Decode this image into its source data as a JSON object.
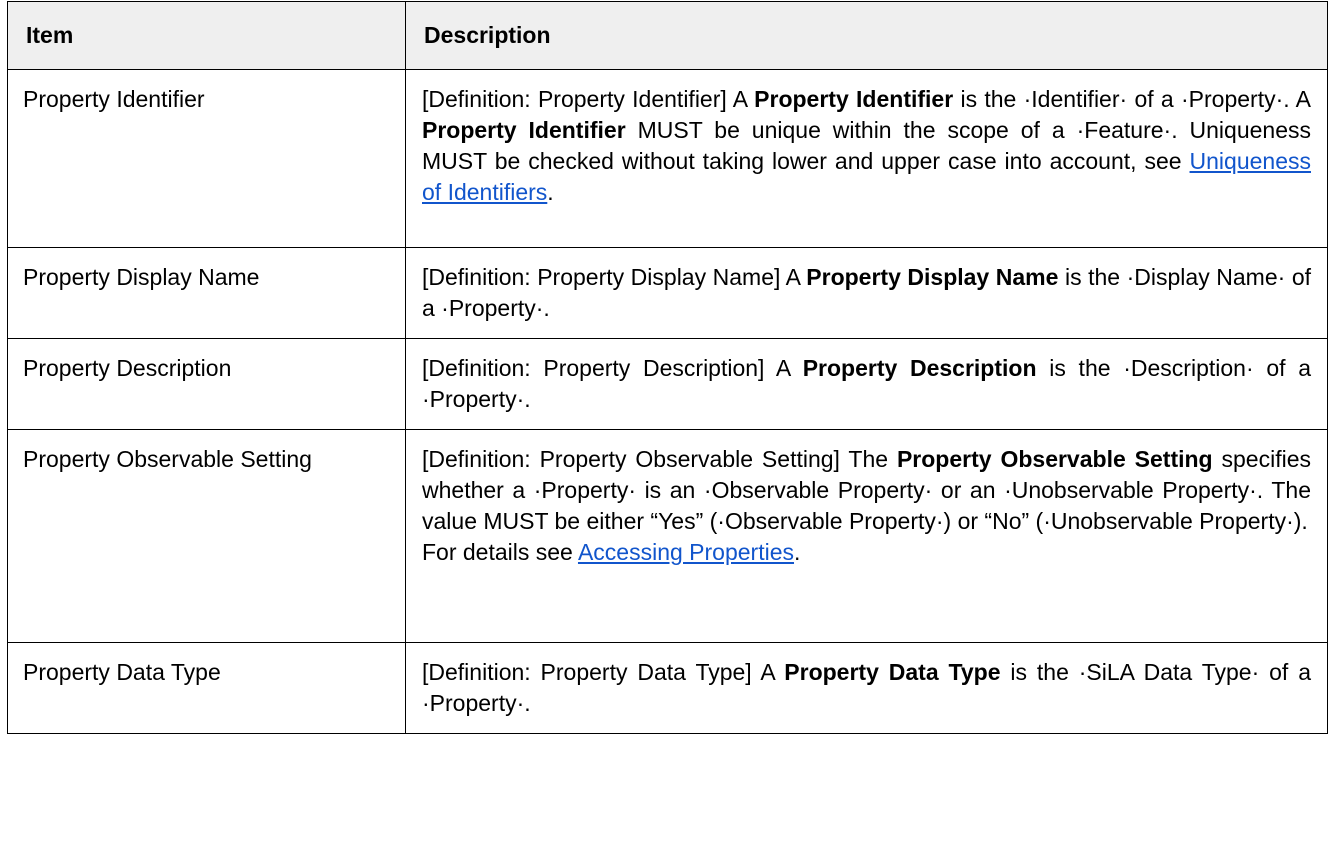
{
  "table": {
    "headers": {
      "item": "Item",
      "description": "Description"
    },
    "rows": [
      {
        "item": "Property Identifier",
        "desc": {
          "t1": "[Definition: Property Identifier] A ",
          "b1": "Property Identifier",
          "t2": " is the ·Identifier· of a ·Property·. A ",
          "b2": "Property Identifier",
          "t3": " MUST be unique within the scope of a ·Feature·. Uniqueness MUST be checked without taking lower and upper case into account, see ",
          "link": "Uniqueness of Identifiers",
          "t4": "."
        }
      },
      {
        "item": "Property Display Name",
        "desc": {
          "t1": "[Definition: Property Display Name] A ",
          "b1": "Property Display Name",
          "t2": " is the ·Display Name· of a ·Property·."
        }
      },
      {
        "item": "Property Description",
        "desc": {
          "t1": "[Definition: Property Description] A ",
          "b1": "Property Description",
          "t2": " is the ·Description· of a ·Property·."
        }
      },
      {
        "item": "Property Observable Setting",
        "desc": {
          "t1": "[Definition: Property Observable Setting] The ",
          "b1": "Property Observable Setting",
          "t2": " specifies whether a ·Property· is an ·Observable Property· or an ·Unobservable Property·. The value MUST be either “Yes” (·Observable Property·) or “No” (·Unobservable Property·).",
          "t3": "For details see ",
          "link": "Accessing Properties",
          "t4": "."
        }
      },
      {
        "item": "Property Data Type",
        "desc": {
          "t1": "[Definition: Property Data Type] A ",
          "b1": "Property Data Type",
          "t2": " is the ·SiLA Data Type· of a ·Property·."
        }
      }
    ]
  }
}
